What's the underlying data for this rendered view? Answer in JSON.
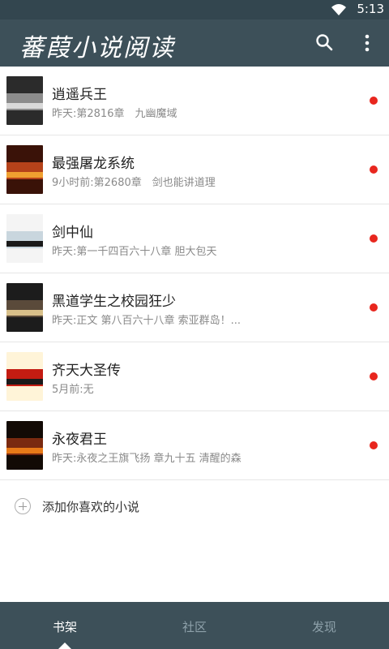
{
  "status_bar": {
    "time": "5:13"
  },
  "app_bar": {
    "title": "蕃葭小说阅读",
    "search_icon": "search-icon",
    "more_icon": "more-vert-icon"
  },
  "books": [
    {
      "title": "逍遥兵王",
      "subtitle": "昨天:第2816章　九幽魔域",
      "unread": true,
      "cover_colors": [
        "#2b2b2b",
        "#8c8c8c",
        "#d9d9d9"
      ]
    },
    {
      "title": "最强屠龙系统",
      "subtitle": "9小时前:第2680章　剑也能讲道理",
      "unread": true,
      "cover_colors": [
        "#3a1208",
        "#b5421a",
        "#f0a030"
      ]
    },
    {
      "title": "剑中仙",
      "subtitle": "昨天:第一千四百六十八章 胆大包天",
      "unread": true,
      "cover_colors": [
        "#f4f4f4",
        "#c9d6de",
        "#1a1a1a"
      ]
    },
    {
      "title": "黑道学生之校园狂少",
      "subtitle": "昨天:正文 第八百六十八章 索亚群岛！...",
      "unread": true,
      "cover_colors": [
        "#1c1c1c",
        "#5a4a3a",
        "#d8c08a"
      ]
    },
    {
      "title": "齐天大圣传",
      "subtitle": "5月前:无",
      "unread": true,
      "cover_colors": [
        "#fff4d8",
        "#c41c12",
        "#1a1a1a"
      ]
    },
    {
      "title": "永夜君王",
      "subtitle": "昨天:永夜之王旗飞扬 章九十五 清醒的森",
      "unread": true,
      "cover_colors": [
        "#120a05",
        "#7a2a10",
        "#e87a18"
      ]
    }
  ],
  "add_row": {
    "label": "添加你喜欢的小说"
  },
  "bottom_nav": [
    {
      "label": "书架",
      "active": true
    },
    {
      "label": "社区",
      "active": false
    },
    {
      "label": "发现",
      "active": false
    }
  ],
  "colors": {
    "accent": "#3d5059",
    "status_bar": "#33464f",
    "unread_dot": "#e8261e"
  }
}
